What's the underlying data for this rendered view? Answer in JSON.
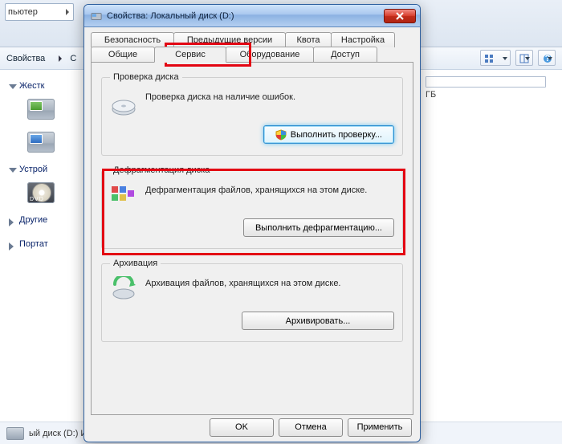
{
  "explorer": {
    "breadcrumb": "пьютер",
    "toolbar": {
      "properties": "Свойства",
      "extra": "С"
    },
    "nav": {
      "hdd_group": "Жестк",
      "devices_group": "Устрой",
      "other_group": "Другие",
      "portable_group": "Портат"
    },
    "right": {
      "gb": "ГБ"
    },
    "status": "ый диск (D:)  Исп"
  },
  "dialog": {
    "title": "Свойства: Локальный диск (D:)",
    "tabs_top": [
      "Безопасность",
      "Предыдущие версии",
      "Квота",
      "Настройка"
    ],
    "tabs_bottom": [
      "Общие",
      "Сервис",
      "Оборудование",
      "Доступ"
    ],
    "check": {
      "legend": "Проверка диска",
      "text": "Проверка диска на наличие ошибок.",
      "button": "Выполнить проверку..."
    },
    "defrag": {
      "legend": "Дефрагментация диска",
      "text": "Дефрагментация файлов, хранящихся на этом диске.",
      "button": "Выполнить дефрагментацию..."
    },
    "backup": {
      "legend": "Архивация",
      "text": "Архивация файлов, хранящихся на этом диске.",
      "button": "Архивировать..."
    },
    "buttons": {
      "ok": "OK",
      "cancel": "Отмена",
      "apply": "Применить"
    }
  }
}
